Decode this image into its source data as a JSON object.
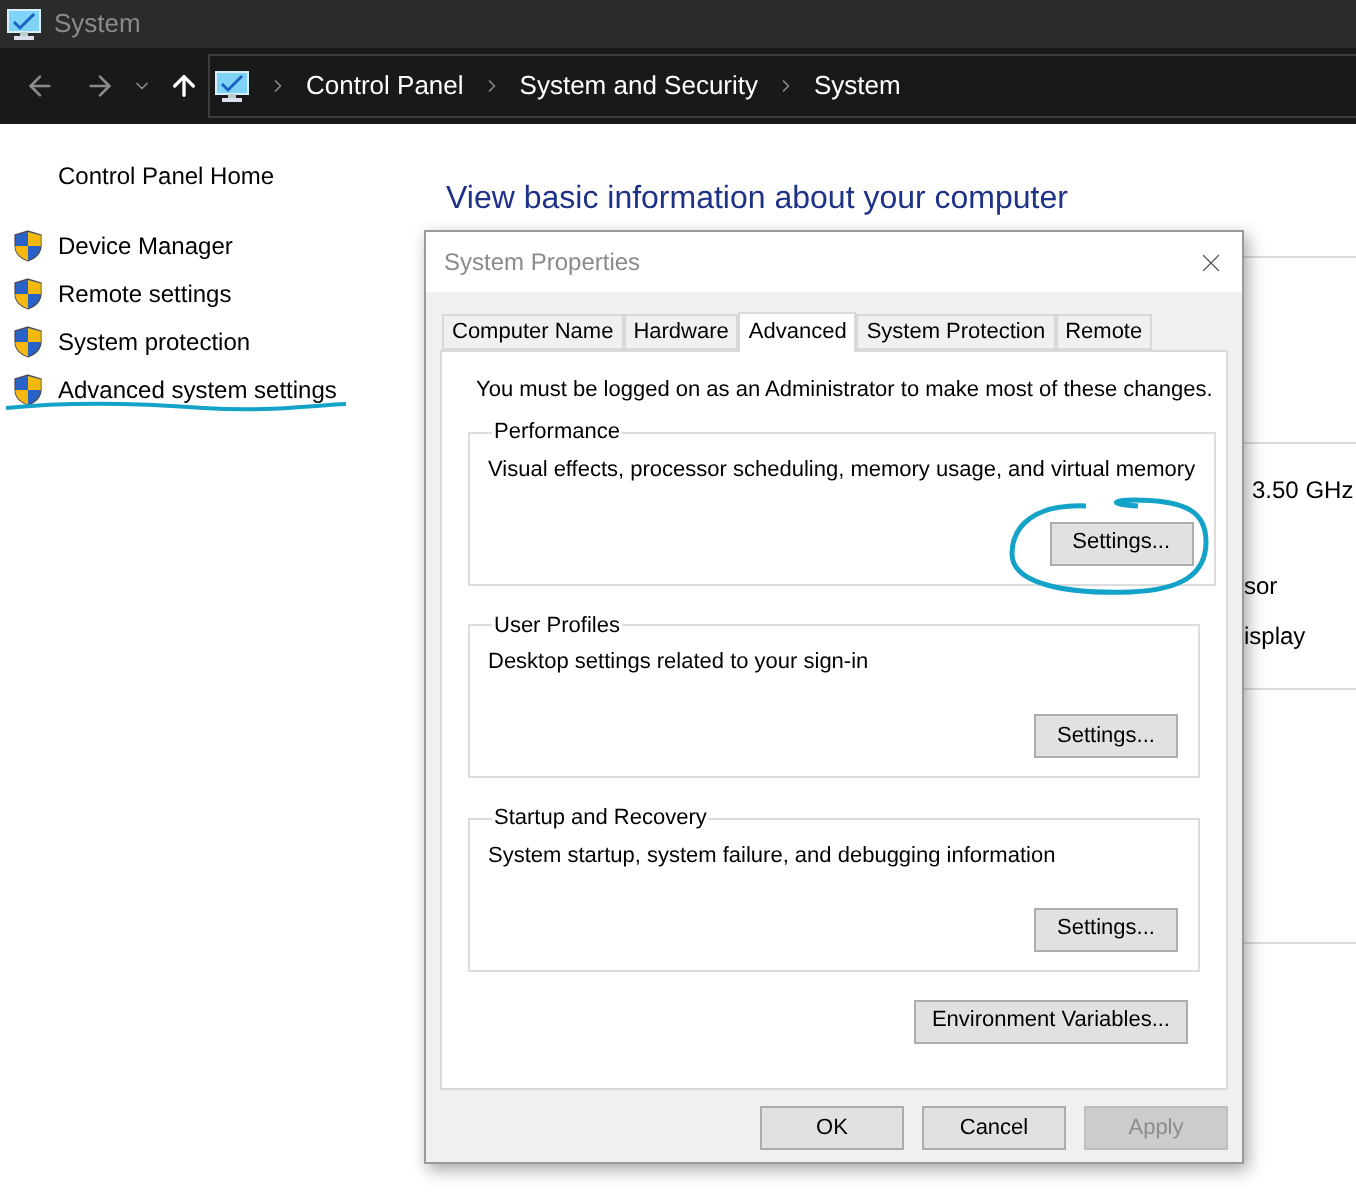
{
  "window": {
    "title": "System"
  },
  "address_bar": {
    "breadcrumbs": [
      "Control Panel",
      "System and Security",
      "System"
    ]
  },
  "sidebar": {
    "home": "Control Panel Home",
    "items": [
      {
        "label": "Device Manager",
        "highlighted": false
      },
      {
        "label": "Remote settings",
        "highlighted": false
      },
      {
        "label": "System protection",
        "highlighted": false
      },
      {
        "label": "Advanced system settings",
        "highlighted": true
      }
    ]
  },
  "main": {
    "heading": "View basic information about your computer",
    "fragments": [
      "3.50 GHz",
      "sor",
      "isplay"
    ]
  },
  "dialog": {
    "title": "System Properties",
    "tabs": [
      {
        "label": "Computer Name",
        "selected": false
      },
      {
        "label": "Hardware",
        "selected": false
      },
      {
        "label": "Advanced",
        "selected": true
      },
      {
        "label": "System Protection",
        "selected": false
      },
      {
        "label": "Remote",
        "selected": false
      }
    ],
    "notice": "You must be logged on as an Administrator to make most of these changes.",
    "groups": [
      {
        "title": "Performance",
        "description": "Visual effects, processor scheduling, memory usage, and virtual memory",
        "button": "Settings...",
        "circled": true
      },
      {
        "title": "User Profiles",
        "description": "Desktop settings related to your sign-in",
        "button": "Settings...",
        "circled": false
      },
      {
        "title": "Startup and Recovery",
        "description": "System startup, system failure, and debugging information",
        "button": "Settings...",
        "circled": false
      }
    ],
    "env_button": "Environment Variables...",
    "buttons": [
      {
        "label": "OK",
        "disabled": false
      },
      {
        "label": "Cancel",
        "disabled": false
      },
      {
        "label": "Apply",
        "disabled": true
      }
    ]
  }
}
